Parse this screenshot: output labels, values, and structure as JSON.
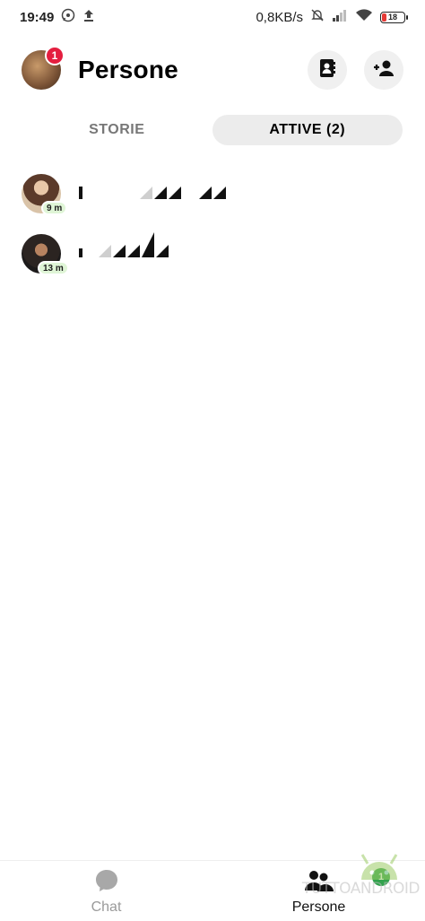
{
  "status_bar": {
    "time": "19:49",
    "network_speed": "0,8KB/s",
    "battery_level": "18",
    "icons": [
      "whatsapp-icon",
      "upload-icon",
      "mute-icon",
      "signal-icon",
      "wifi-icon",
      "battery-icon"
    ]
  },
  "header": {
    "title": "Persone",
    "notification_count": "1",
    "actions": [
      "contacts-icon",
      "add-person-icon"
    ]
  },
  "tabs": [
    {
      "label": "STORIE",
      "selected": false
    },
    {
      "label": "ATTIVE (2)",
      "selected": true
    }
  ],
  "active_people": [
    {
      "active_time": "9 m"
    },
    {
      "active_time": "13 m"
    }
  ],
  "bottom_nav": {
    "items": [
      {
        "label": "Chat",
        "icon": "chat-bubble-icon",
        "selected": false
      },
      {
        "label": "Persone",
        "icon": "people-icon",
        "selected": true,
        "badge": "1"
      }
    ]
  },
  "watermark": {
    "text": "TUTTOANDROID"
  },
  "colors": {
    "accent_red": "#e41e3f",
    "active_green": "#31a24c",
    "active_badge_bg": "#dff5d6"
  }
}
